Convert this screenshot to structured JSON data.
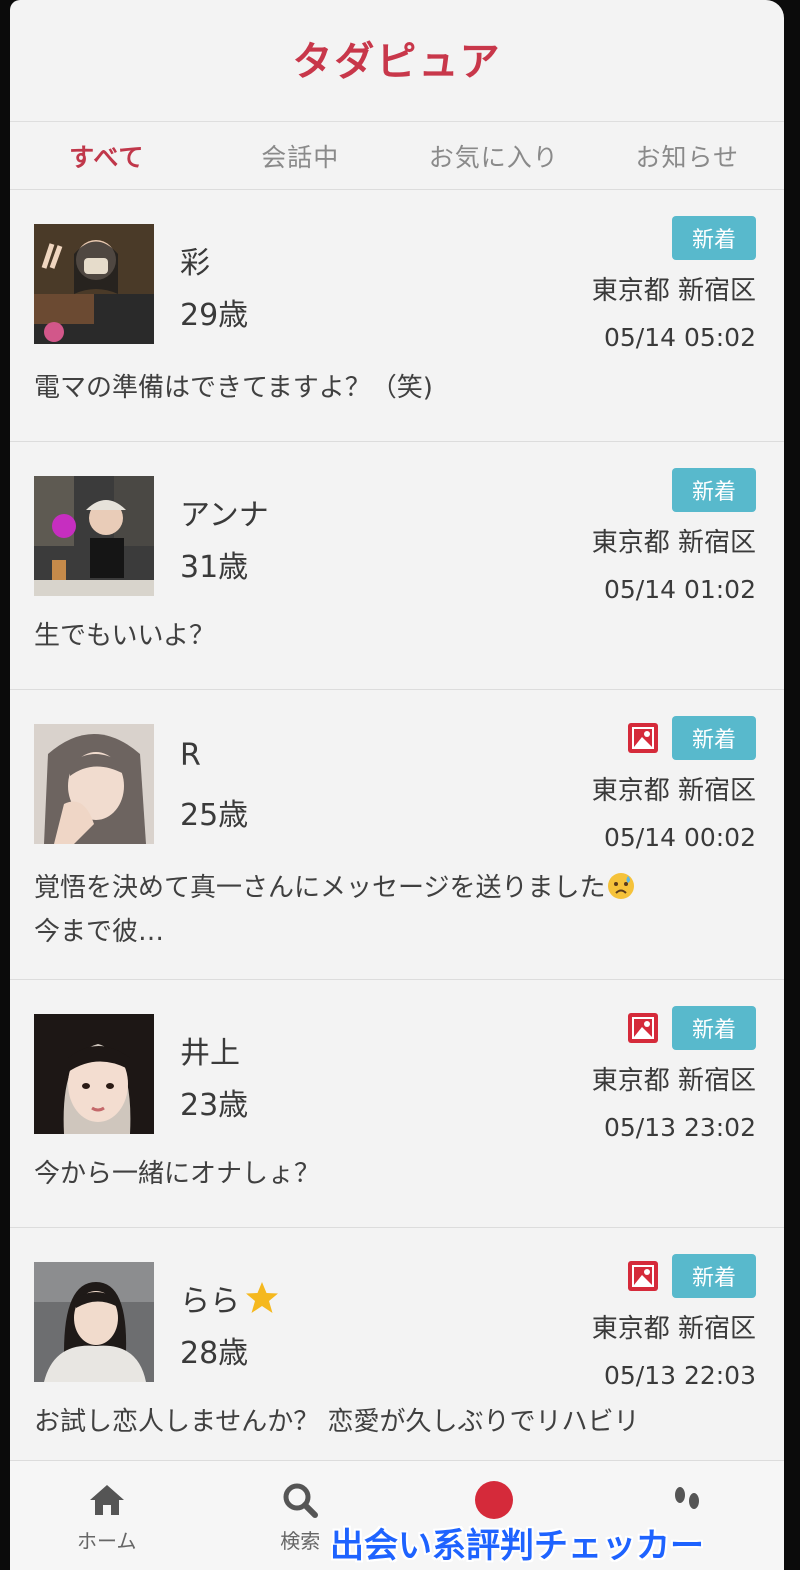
{
  "app": {
    "title": "タダピュア"
  },
  "tabs": [
    {
      "label": "すべて",
      "active": true
    },
    {
      "label": "会話中",
      "active": false
    },
    {
      "label": "お気に入り",
      "active": false
    },
    {
      "label": "お知らせ",
      "active": false
    }
  ],
  "badge_new_label": "新着",
  "colors": {
    "accent": "#c8374a",
    "badge": "#58b9cc",
    "photo_icon": "#d52a3a"
  },
  "messages": [
    {
      "name": "彩",
      "age": "29歳",
      "location": "東京都 新宿区",
      "datetime": "05/14 05:02",
      "preview": "電マの準備はできてますよ？（笑)",
      "has_photo_icon": false
    },
    {
      "name": "アンナ",
      "age": "31歳",
      "location": "東京都 新宿区",
      "datetime": "05/14 01:02",
      "preview": "生でもいいよ？",
      "has_photo_icon": false
    },
    {
      "name": "R",
      "age": "25歳",
      "location": "東京都 新宿区",
      "datetime": "05/14 00:02",
      "preview_line1": "覚悟を決めて真一さんにメッセージを送りました",
      "preview_line2": "今まで彼…",
      "has_photo_icon": true
    },
    {
      "name": "井上",
      "age": "23歳",
      "location": "東京都 新宿区",
      "datetime": "05/13 23:02",
      "preview": "今から一緒にオナしょ？",
      "has_photo_icon": true
    },
    {
      "name": "らら",
      "age": "28歳",
      "location": "東京都 新宿区",
      "datetime": "05/13 22:03",
      "preview": "お試し恋人しませんか？ 恋愛が久しぶりでリハビリ",
      "has_photo_icon": true,
      "has_star": true
    }
  ],
  "bottom_nav": [
    {
      "label": "ホーム",
      "icon": "home-icon"
    },
    {
      "label": "検索",
      "icon": "search-icon"
    },
    {
      "label": "",
      "icon": "notification-dot"
    },
    {
      "label": "",
      "icon": "footprints-icon"
    }
  ],
  "watermark": "出会い系評判チェッカー"
}
